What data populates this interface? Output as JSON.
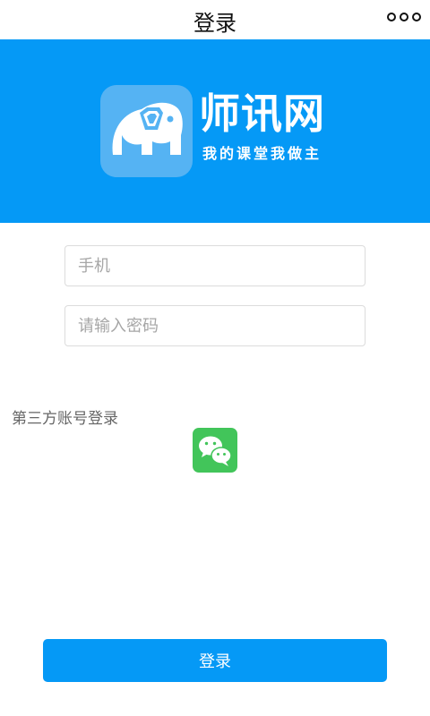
{
  "nav": {
    "title": "登录",
    "more_icon": "more-dots-icon"
  },
  "banner": {
    "background_color": "#0599f6",
    "logo_icon": "elephant-icon",
    "brand_name": "师讯网",
    "slogan": "我的课堂我做主"
  },
  "form": {
    "phone_placeholder": "手机",
    "password_placeholder": "请输入密码"
  },
  "third_party": {
    "label": "第三方账号登录",
    "wechat_icon": "wechat-icon",
    "wechat_color": "#42c55a"
  },
  "login_button": {
    "label": "登录"
  }
}
